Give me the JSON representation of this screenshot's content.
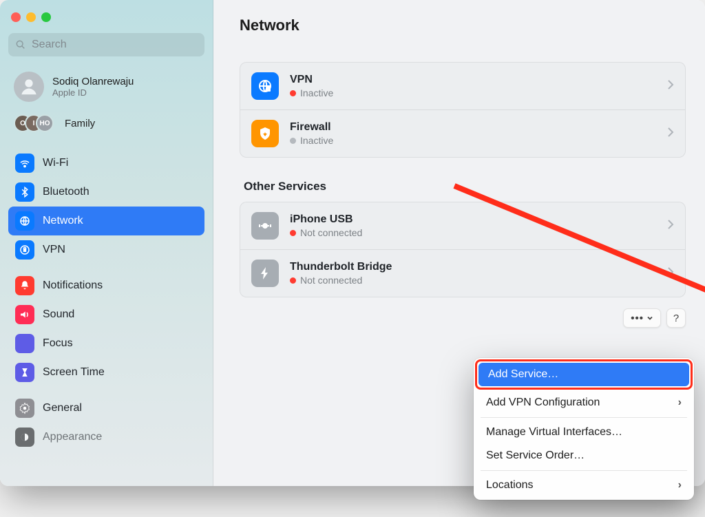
{
  "search": {
    "placeholder": "Search"
  },
  "account": {
    "name": "Sodiq Olanrewaju",
    "sub": "Apple ID"
  },
  "family_label": "Family",
  "sidebar": {
    "items": [
      {
        "label": "Wi-Fi"
      },
      {
        "label": "Bluetooth"
      },
      {
        "label": "Network"
      },
      {
        "label": "VPN"
      },
      {
        "label": "Notifications"
      },
      {
        "label": "Sound"
      },
      {
        "label": "Focus"
      },
      {
        "label": "Screen Time"
      },
      {
        "label": "General"
      },
      {
        "label": "Appearance"
      }
    ]
  },
  "page_title": "Network",
  "status_colors": {
    "inactive_red": "#ff3b30",
    "inactive_gray": "#b5b9be"
  },
  "sections": {
    "primary": [
      {
        "title": "VPN",
        "status": "Inactive",
        "dot": "red"
      },
      {
        "title": "Firewall",
        "status": "Inactive",
        "dot": "gray"
      }
    ],
    "other_label": "Other Services",
    "other": [
      {
        "title": "iPhone USB",
        "status": "Not connected",
        "dot": "red"
      },
      {
        "title": "Thunderbolt Bridge",
        "status": "Not connected",
        "dot": "red"
      }
    ]
  },
  "footer": {
    "more": "•••",
    "help": "?"
  },
  "menu": {
    "items": [
      "Add Service…",
      "Add VPN Configuration",
      "Manage Virtual Interfaces…",
      "Set Service Order…",
      "Locations"
    ]
  }
}
